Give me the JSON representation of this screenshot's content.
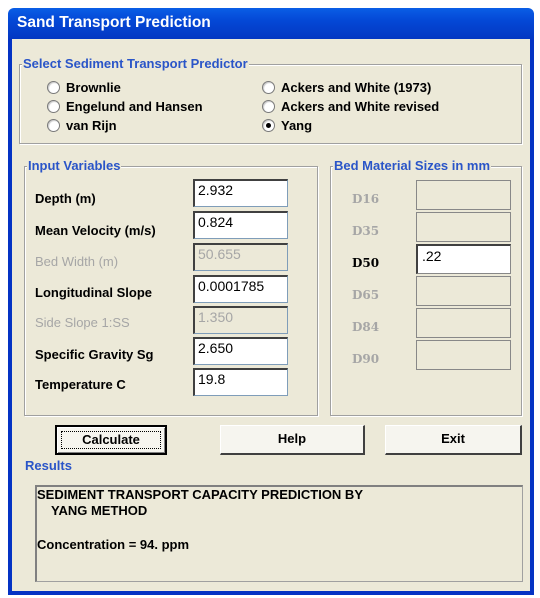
{
  "window": {
    "title": "Sand Transport Prediction"
  },
  "predictor": {
    "legend": "Select Sediment Transport Predictor",
    "options": [
      {
        "label": "Brownlie",
        "selected": false
      },
      {
        "label": "Engelund and Hansen",
        "selected": false
      },
      {
        "label": "van Rijn",
        "selected": false
      },
      {
        "label": "Ackers and White (1973)",
        "selected": false
      },
      {
        "label": "Ackers and White revised",
        "selected": false
      },
      {
        "label": "Yang",
        "selected": true
      }
    ]
  },
  "inputs": {
    "legend": "Input Variables",
    "depth": {
      "label": "Depth (m)",
      "value": "2.932"
    },
    "velocity": {
      "label": "Mean Velocity (m/s)",
      "value": "0.824"
    },
    "bed_width": {
      "label": "Bed Width (m)",
      "value": "50.655"
    },
    "slope": {
      "label": "Longitudinal Slope",
      "value": "0.0001785"
    },
    "side_slope": {
      "label": "Side Slope 1:SS",
      "value": "1.350"
    },
    "gravity": {
      "label": "Specific Gravity Sg",
      "value": "2.650"
    },
    "temperature": {
      "label": "Temperature C",
      "value": "19.8"
    }
  },
  "bed": {
    "legend": "Bed Material Sizes in mm",
    "items": [
      {
        "label": "D16",
        "value": ""
      },
      {
        "label": "D35",
        "value": ""
      },
      {
        "label": "D50",
        "value": ".22"
      },
      {
        "label": "D65",
        "value": ""
      },
      {
        "label": "D84",
        "value": ""
      },
      {
        "label": "D90",
        "value": ""
      }
    ]
  },
  "buttons": {
    "calculate": "Calculate",
    "help": "Help",
    "exit": "Exit"
  },
  "results": {
    "legend": "Results",
    "line1": "SEDIMENT TRANSPORT CAPACITY PREDICTION BY",
    "line2": "YANG METHOD",
    "line3": "Concentration = 94. ppm"
  },
  "colors": {
    "titlebar": "#0448d6",
    "legend_text": "#2a55c8",
    "client_bg": "#ece9d8"
  }
}
